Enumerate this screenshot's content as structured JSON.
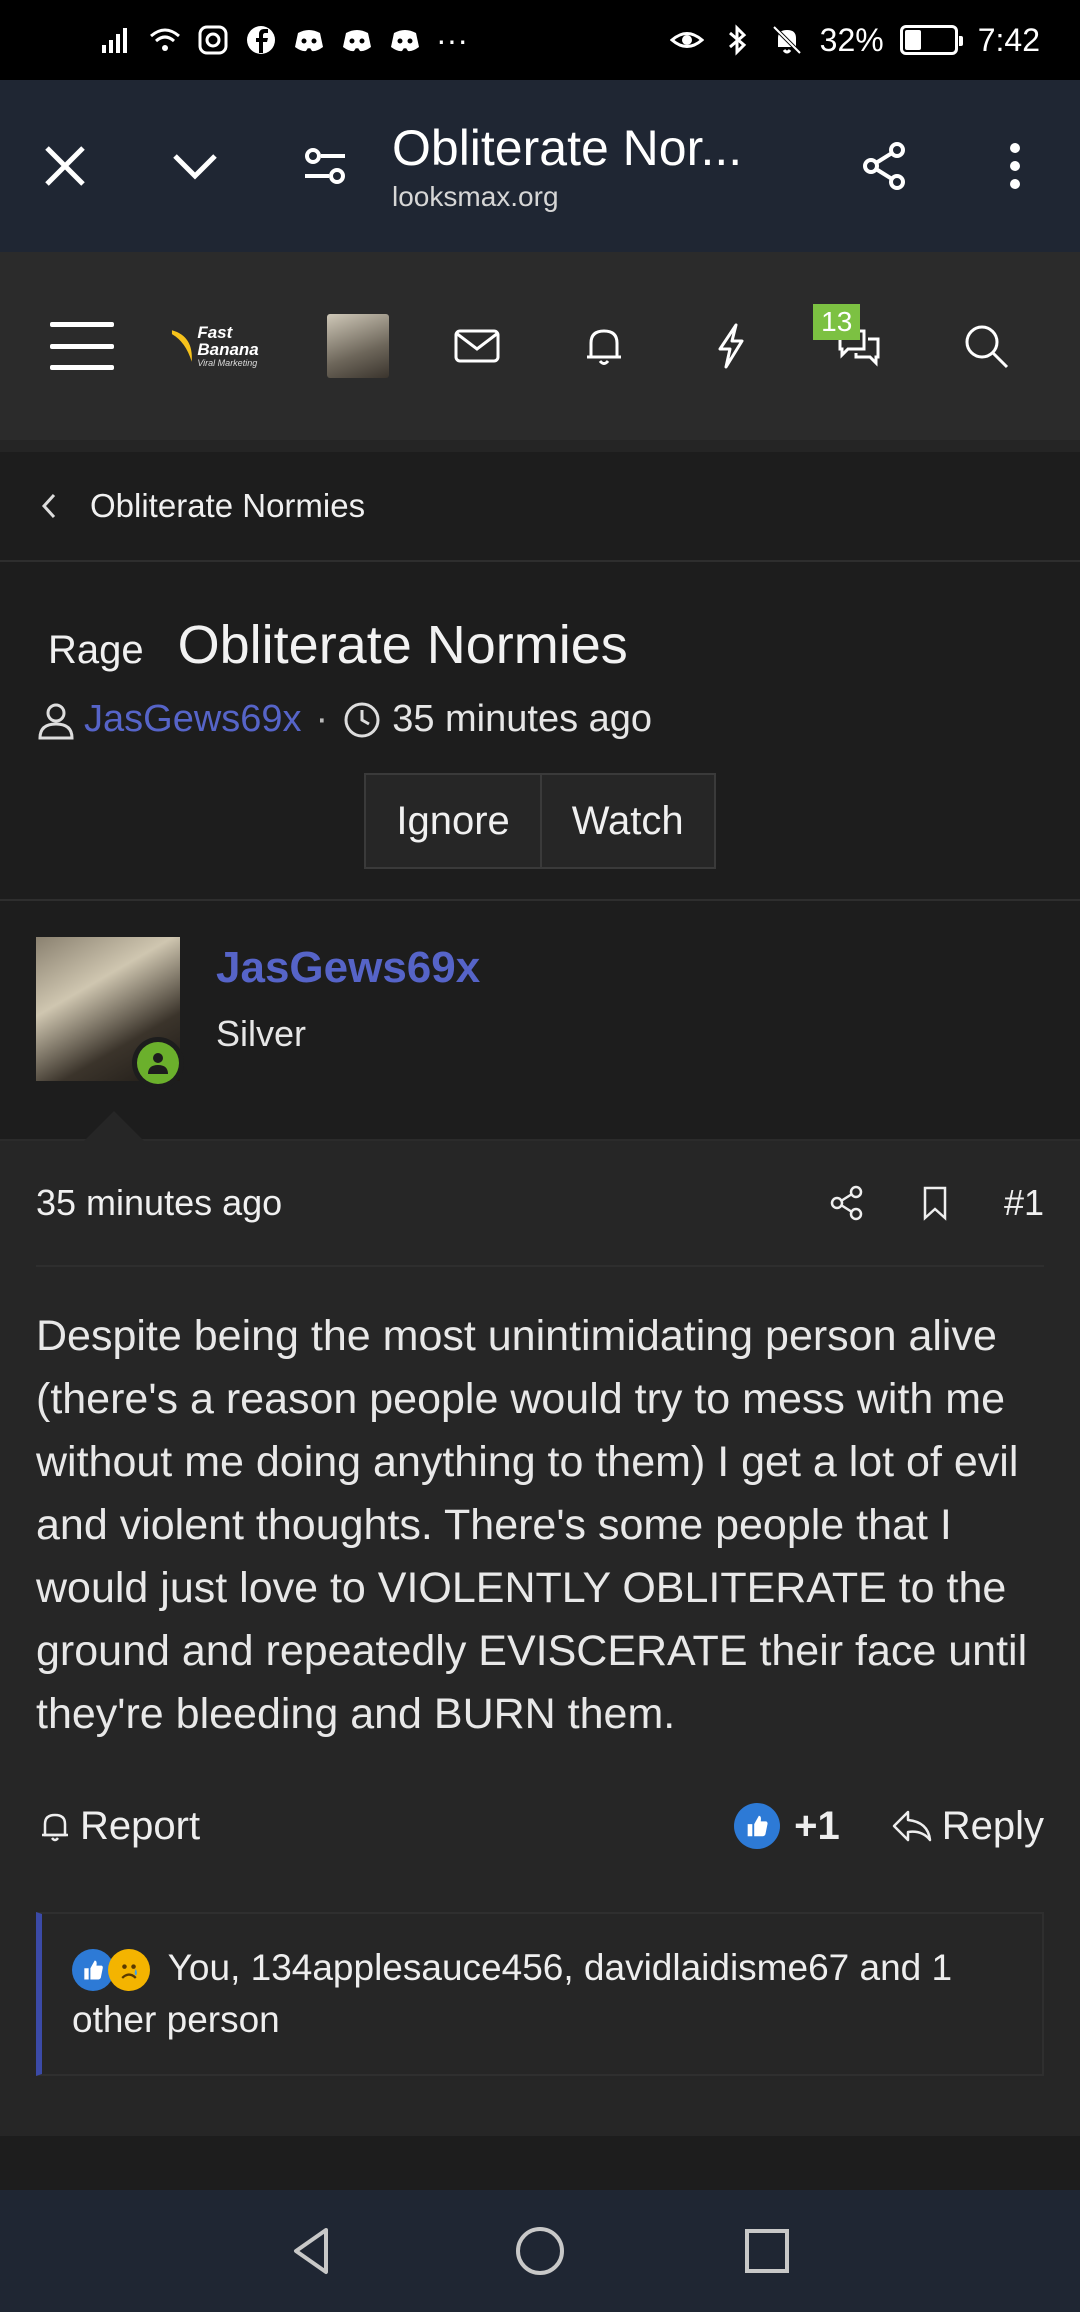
{
  "status_bar": {
    "signal_icon": "signal-bars-icon",
    "wifi_icon": "wifi-icon",
    "app_icons": [
      "instagram-icon",
      "facebook-icon",
      "discord-icon",
      "discord-icon",
      "discord-icon"
    ],
    "more": "···",
    "battery_percent": "32%",
    "battery_level": 0.32,
    "time": "7:42"
  },
  "browser": {
    "title": "Obliterate Nor...",
    "url": "looksmax.org"
  },
  "forum_nav": {
    "logo_text": "Fast Banana",
    "logo_subtext": "Viral Marketing",
    "conversations_badge": "13"
  },
  "breadcrumb": {
    "label": "Obliterate Normies"
  },
  "thread": {
    "prefix": "Rage",
    "title": "Obliterate Normies",
    "author": "JasGews69x",
    "separator": "·",
    "time": "35 minutes ago",
    "ignore_label": "Ignore",
    "watch_label": "Watch"
  },
  "post": {
    "username": "JasGews69x",
    "rank": "Silver",
    "time": "35 minutes ago",
    "number": "#1",
    "body": "Despite being the most unintimidating person alive (there's a reason people would try to mess with me without me doing anything to them) I get a lot of evil and violent thoughts. There's some people that I would just love to VIOLENTLY OBLITERATE to the ground and repeatedly EVISCERATE their face until they're bleeding and BURN them.",
    "report_label": "Report",
    "score": "+1",
    "reply_label": "Reply",
    "reactions_text": "You, 134applesauce456, davidlaidisme67 and 1 other person"
  },
  "colors": {
    "link": "#5664c8",
    "badge": "#7cc142",
    "online": "#6bb02c",
    "like": "#2d7ad6",
    "accent_border": "#3b4aa7"
  }
}
